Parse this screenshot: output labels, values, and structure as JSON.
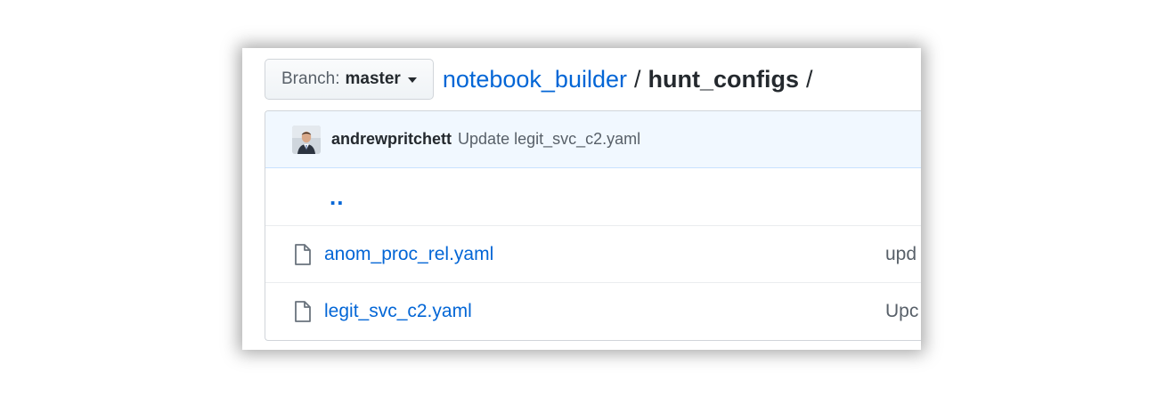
{
  "branch": {
    "prefix": "Branch:",
    "name": "master"
  },
  "breadcrumb": {
    "repo": "notebook_builder",
    "separator": "/",
    "current": "hunt_configs",
    "trailing_separator": "/"
  },
  "commit": {
    "author": "andrewpritchett",
    "message": "Update legit_svc_c2.yaml"
  },
  "parent_link": "..",
  "files": [
    {
      "name": "anom_proc_rel.yaml",
      "icon": "file-icon",
      "commit_message": "upd"
    },
    {
      "name": "legit_svc_c2.yaml",
      "icon": "file-icon",
      "commit_message": "Upc"
    }
  ],
  "colors": {
    "link": "#0366d6",
    "commit_bar_bg": "#f1f8ff",
    "text": "#24292e",
    "muted": "#586069"
  }
}
